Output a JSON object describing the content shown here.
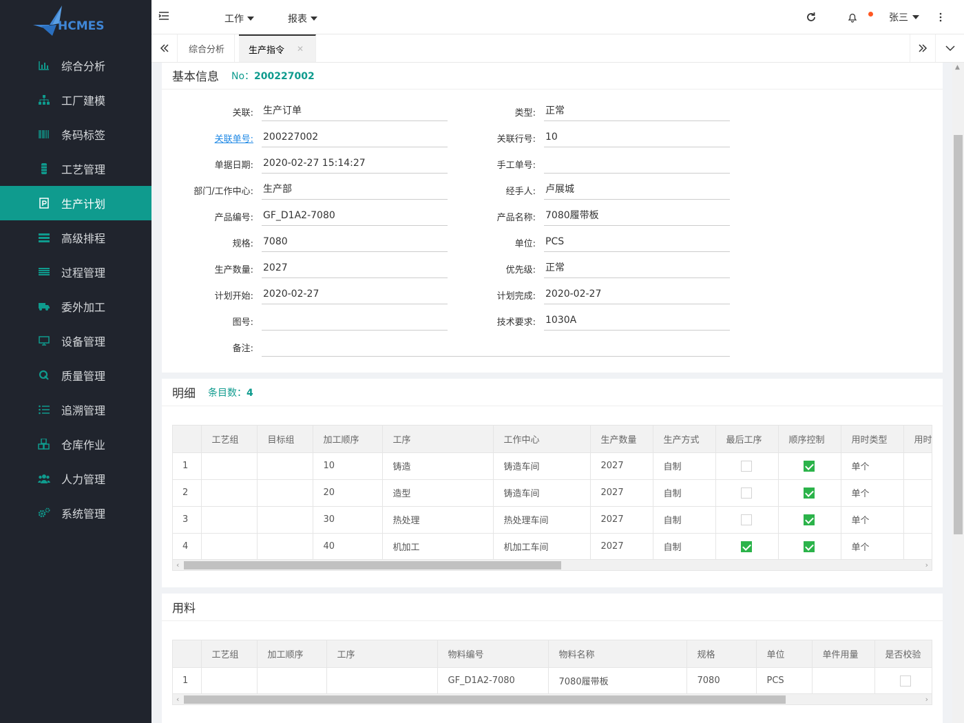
{
  "app": {
    "logo_text": "HCMES"
  },
  "sidebar": {
    "items": [
      {
        "label": "综合分析",
        "icon": "bar-chart-icon"
      },
      {
        "label": "工厂建模",
        "icon": "sitemap-icon"
      },
      {
        "label": "条码标签",
        "icon": "barcode-icon"
      },
      {
        "label": "工艺管理",
        "icon": "process-icon"
      },
      {
        "label": "生产计划",
        "icon": "document-icon",
        "active": true
      },
      {
        "label": "高级排程",
        "icon": "schedule-icon"
      },
      {
        "label": "过程管理",
        "icon": "list-icon"
      },
      {
        "label": "委外加工",
        "icon": "truck-icon"
      },
      {
        "label": "设备管理",
        "icon": "monitor-icon"
      },
      {
        "label": "质量管理",
        "icon": "quality-icon"
      },
      {
        "label": "追溯管理",
        "icon": "trace-list-icon"
      },
      {
        "label": "仓库作业",
        "icon": "cubes-icon"
      },
      {
        "label": "人力管理",
        "icon": "users-icon"
      },
      {
        "label": "系统管理",
        "icon": "cogs-icon"
      }
    ]
  },
  "header": {
    "nav": [
      "工作",
      "报表"
    ],
    "user": "张三",
    "accent": "#0f9b8e",
    "notify_color": "#ff5722"
  },
  "tabs": [
    "综合分析",
    "生产指令"
  ],
  "basic": {
    "title": "基本信息",
    "no_label": "No：",
    "no_value": "200227002",
    "fields_left": [
      {
        "label": "关联:",
        "value": "生产订单"
      },
      {
        "label": "关联单号:",
        "value": "200227002",
        "link": true
      },
      {
        "label": "单据日期:",
        "value": "2020-02-27 15:14:27"
      },
      {
        "label": "部门/工作中心:",
        "value": "生产部"
      },
      {
        "label": "产品编号:",
        "value": "GF_D1A2-7080"
      },
      {
        "label": "规格:",
        "value": "7080"
      },
      {
        "label": "生产数量:",
        "value": "2027"
      },
      {
        "label": "计划开始:",
        "value": "2020-02-27"
      },
      {
        "label": "图号:",
        "value": ""
      }
    ],
    "fields_right": [
      {
        "label": "类型:",
        "value": "正常"
      },
      {
        "label": "关联行号:",
        "value": "10"
      },
      {
        "label": "手工单号:",
        "value": ""
      },
      {
        "label": "经手人:",
        "value": "卢展城"
      },
      {
        "label": "产品名称:",
        "value": "7080履带板"
      },
      {
        "label": "单位:",
        "value": "PCS"
      },
      {
        "label": "优先级:",
        "value": "正常"
      },
      {
        "label": "计划完成:",
        "value": "2020-02-27"
      },
      {
        "label": "技术要求:",
        "value": "1030A"
      }
    ],
    "remark": {
      "label": "备注:",
      "value": ""
    }
  },
  "detail": {
    "title": "明细",
    "count_label": "条目数：",
    "count": "4",
    "columns": [
      "",
      "工艺组",
      "目标组",
      "加工顺序",
      "工序",
      "工作中心",
      "生产数量",
      "生产方式",
      "最后工序",
      "顺序控制",
      "用时类型",
      "用时"
    ],
    "rows": [
      {
        "n": "1",
        "g": "",
        "t": "",
        "seq": "10",
        "op": "铸造",
        "wc": "铸造车间",
        "qty": "2027",
        "mode": "自制",
        "last": false,
        "ctrl": true,
        "tt": "单个"
      },
      {
        "n": "2",
        "g": "",
        "t": "",
        "seq": "20",
        "op": "造型",
        "wc": "铸造车间",
        "qty": "2027",
        "mode": "自制",
        "last": false,
        "ctrl": true,
        "tt": "单个"
      },
      {
        "n": "3",
        "g": "",
        "t": "",
        "seq": "30",
        "op": "热处理",
        "wc": "热处理车间",
        "qty": "2027",
        "mode": "自制",
        "last": false,
        "ctrl": true,
        "tt": "单个"
      },
      {
        "n": "4",
        "g": "",
        "t": "",
        "seq": "40",
        "op": "机加工",
        "wc": "机加工车间",
        "qty": "2027",
        "mode": "自制",
        "last": true,
        "ctrl": true,
        "tt": "单个"
      }
    ]
  },
  "material": {
    "title": "用料",
    "columns": [
      "",
      "工艺组",
      "加工顺序",
      "工序",
      "物料编号",
      "物料名称",
      "规格",
      "单位",
      "单件用量",
      "是否校验"
    ],
    "rows": [
      {
        "n": "1",
        "g": "",
        "seq": "",
        "op": "",
        "code": "GF_D1A2-7080",
        "name": "7080履带板",
        "spec": "7080",
        "unit": "PCS",
        "use": "",
        "check": false
      }
    ]
  }
}
